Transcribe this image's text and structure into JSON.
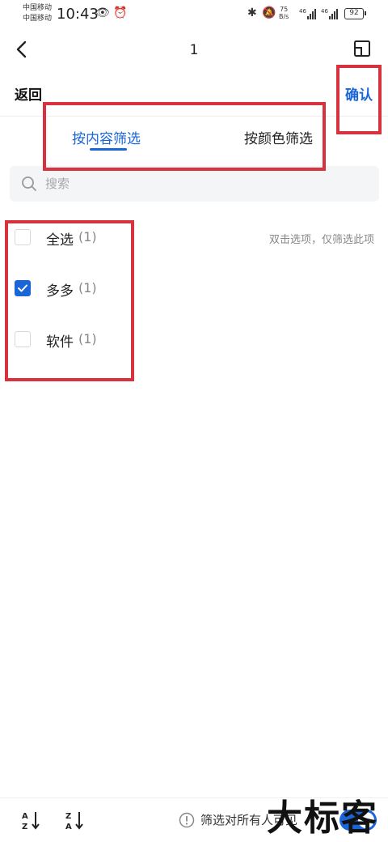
{
  "status_bar": {
    "carrier_1": "中国移动",
    "carrier_2": "中国移动",
    "time": "10:43",
    "net_speed_value": "75",
    "net_speed_unit": "B/s",
    "sim1_label": "46",
    "sim2_label": "46",
    "battery": "92"
  },
  "title_bar": {
    "title": "1"
  },
  "header": {
    "back_label": "返回",
    "confirm_label": "确认"
  },
  "tabs": [
    {
      "label": "按内容筛选",
      "active": true
    },
    {
      "label": "按颜色筛选",
      "active": false
    }
  ],
  "search": {
    "placeholder": "搜索",
    "value": ""
  },
  "hint": "双击选项，仅筛选此项",
  "options": [
    {
      "label": "全选",
      "count": "(1)",
      "checked": false
    },
    {
      "label": "多多",
      "count": "(1)",
      "checked": true
    },
    {
      "label": "软件",
      "count": "(1)",
      "checked": false
    }
  ],
  "bottom_bar": {
    "visibility_text": "筛选对所有人可见",
    "toggle_on": true
  },
  "watermark": "大标客",
  "colors": {
    "accent": "#1a66d9",
    "annotation": "#d9323f"
  }
}
